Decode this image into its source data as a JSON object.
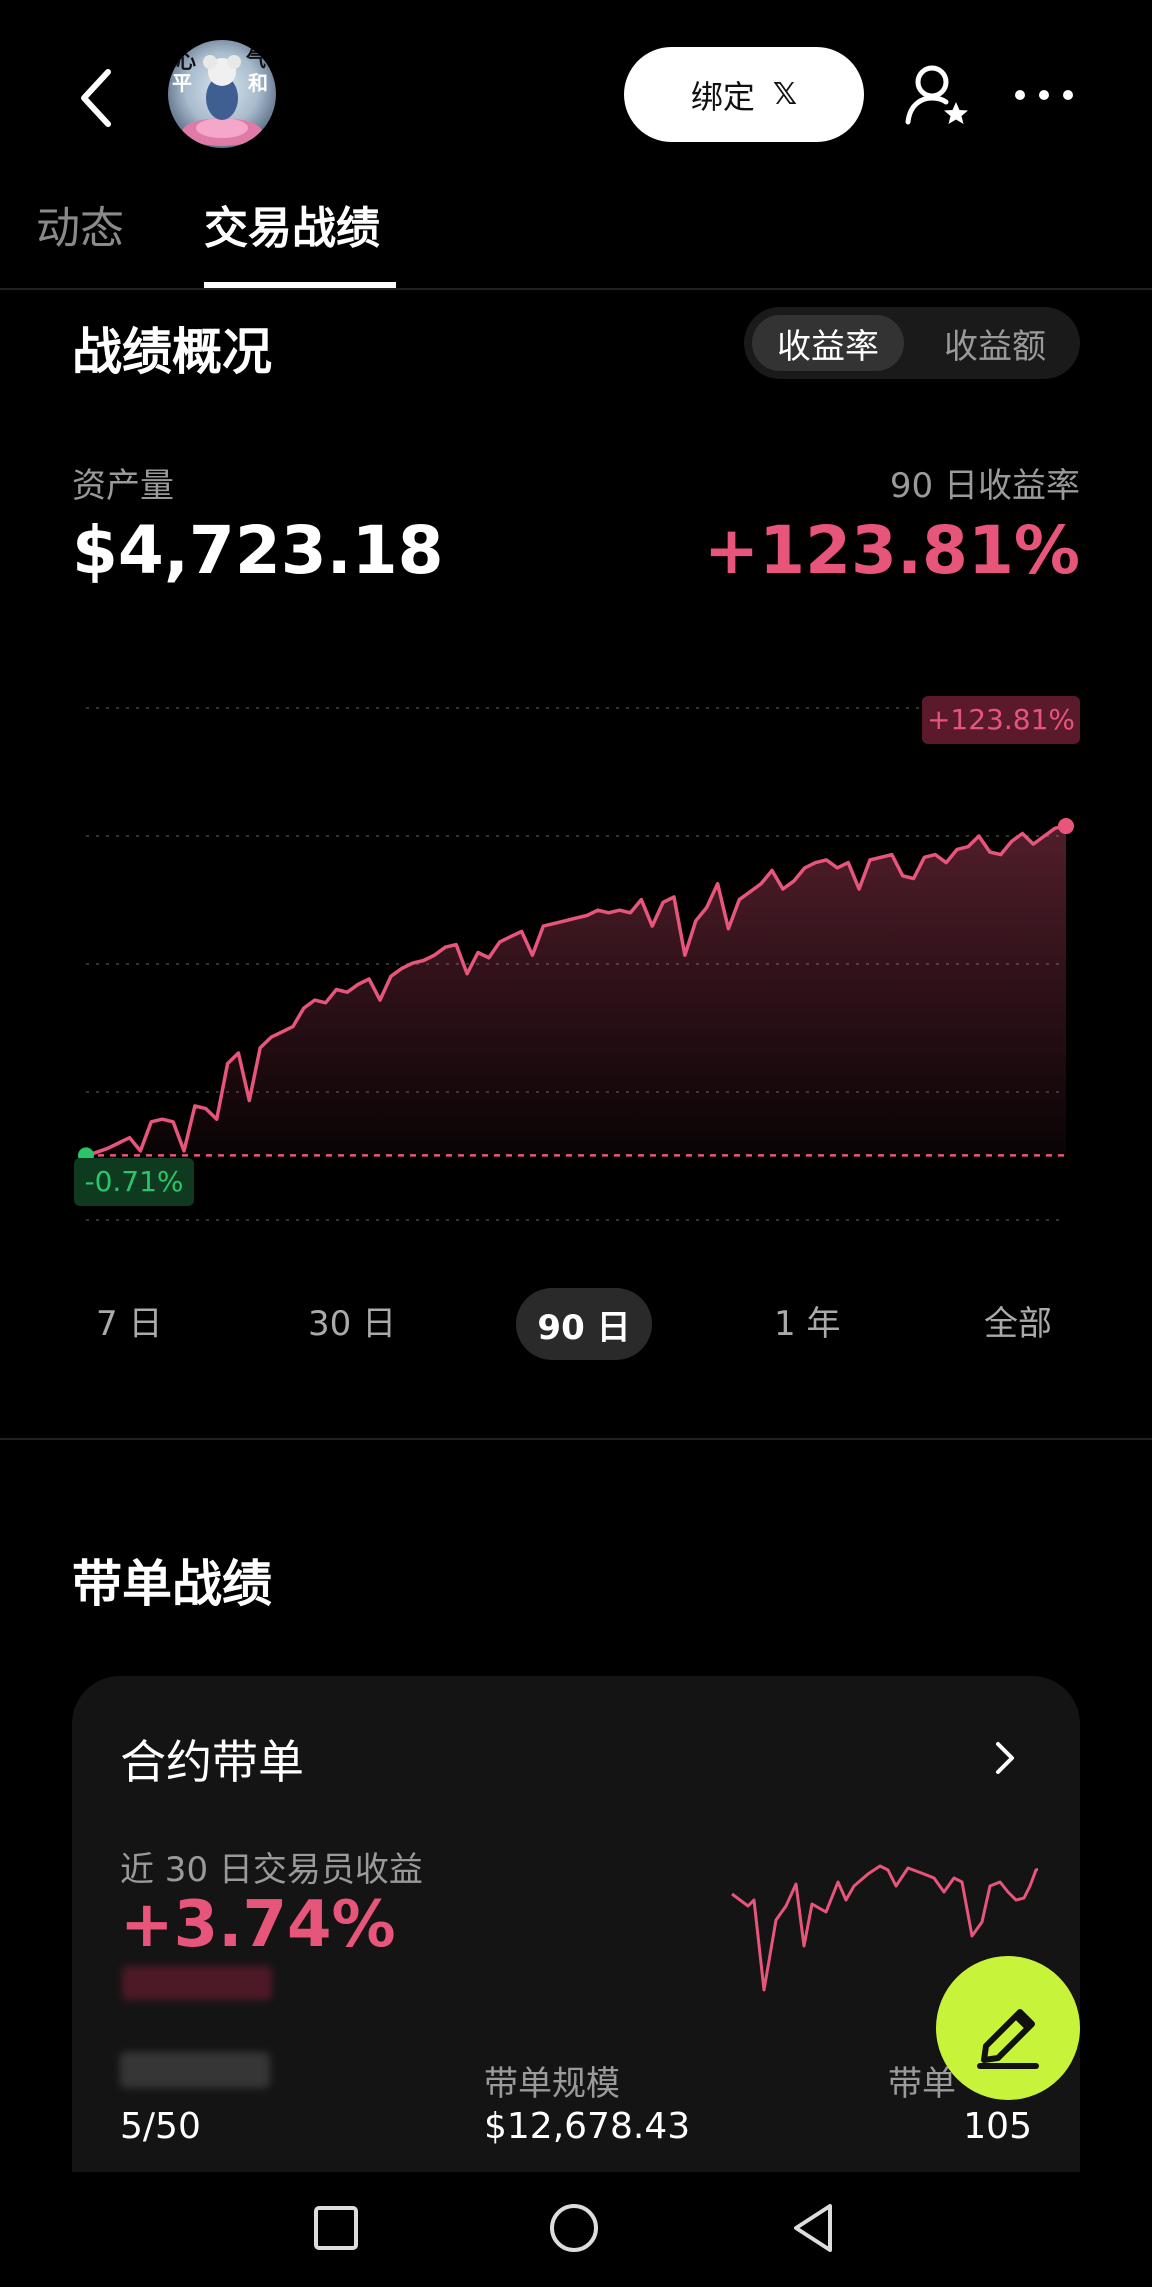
{
  "topbar": {
    "avatar_text": [
      "心",
      "气",
      "平",
      "和"
    ],
    "bind_label": "绑定",
    "bind_x": "𝕏"
  },
  "tabs": [
    {
      "label": "动态"
    },
    {
      "label": "交易战绩"
    }
  ],
  "overview": {
    "title": "战绩概况",
    "toggle": [
      "收益率",
      "收益额"
    ],
    "assets_label": "资产量",
    "assets_value": "$4,723.18",
    "return_label": "90 日收益率",
    "return_value": "+123.81%",
    "chart_max_label": "+123.81%",
    "chart_min_label": "-0.71%"
  },
  "ranges": [
    "7 日",
    "30 日",
    "90 日",
    "1 年",
    "全部"
  ],
  "copy_trading": {
    "title": "带单战绩",
    "card_title": "合约带单",
    "pnl_label": "近 30 日交易员收益",
    "pnl_value": "+3.74%",
    "followers_value": "5/50",
    "scale_label": "带单规模",
    "scale_value": "$12,678.43",
    "orders_label_partial": "带单",
    "orders_value": "105"
  },
  "colors": {
    "accent_pink": "#e8557a",
    "accent_green": "#2cc46b",
    "fab": "#c7f43b"
  },
  "chart_data": {
    "type": "area",
    "title": "",
    "xlabel": "",
    "ylabel": "",
    "ylim": [
      -10,
      145
    ],
    "x": [
      0,
      1,
      2,
      3,
      4,
      5,
      6,
      7,
      8,
      9,
      10,
      11,
      12,
      13,
      14,
      15,
      16,
      17,
      18,
      19,
      20,
      21,
      22,
      23,
      24,
      25,
      26,
      27,
      28,
      29,
      30,
      31,
      32,
      33,
      34,
      35,
      36,
      37,
      38,
      39,
      40,
      41,
      42,
      43,
      44,
      45,
      46,
      47,
      48,
      49,
      50,
      51,
      52,
      53,
      54,
      55,
      56,
      57,
      58,
      59,
      60,
      61,
      62,
      63,
      64,
      65,
      66,
      67,
      68,
      69,
      70,
      71,
      72,
      73,
      74,
      75,
      76,
      77,
      78,
      79,
      80,
      81,
      82,
      83,
      84,
      85,
      86,
      87,
      88,
      89,
      90
    ],
    "series": [
      {
        "values": [
          -0.71,
          0.5,
          2,
          4,
          6,
          1,
          12,
          13,
          12,
          1,
          18,
          17,
          13,
          34,
          38,
          20,
          40,
          44,
          46,
          48,
          55,
          58,
          57,
          62,
          61,
          64,
          66,
          58,
          67,
          70,
          72,
          73,
          75,
          78,
          79,
          68,
          76,
          74,
          80,
          82,
          84,
          75,
          86,
          87,
          88,
          89,
          90,
          92,
          91,
          92,
          91,
          96,
          86,
          95,
          97,
          75,
          88,
          93,
          102,
          85,
          96,
          99,
          102,
          107,
          100,
          103,
          108,
          110,
          111,
          108,
          110,
          100,
          111,
          112,
          113,
          105,
          104,
          112,
          113,
          110,
          115,
          116,
          120,
          114,
          113,
          118,
          121,
          117,
          120,
          123,
          123.81
        ]
      }
    ],
    "grid": true,
    "markers": {
      "start": "-0.71%",
      "end": "+123.81%"
    }
  }
}
